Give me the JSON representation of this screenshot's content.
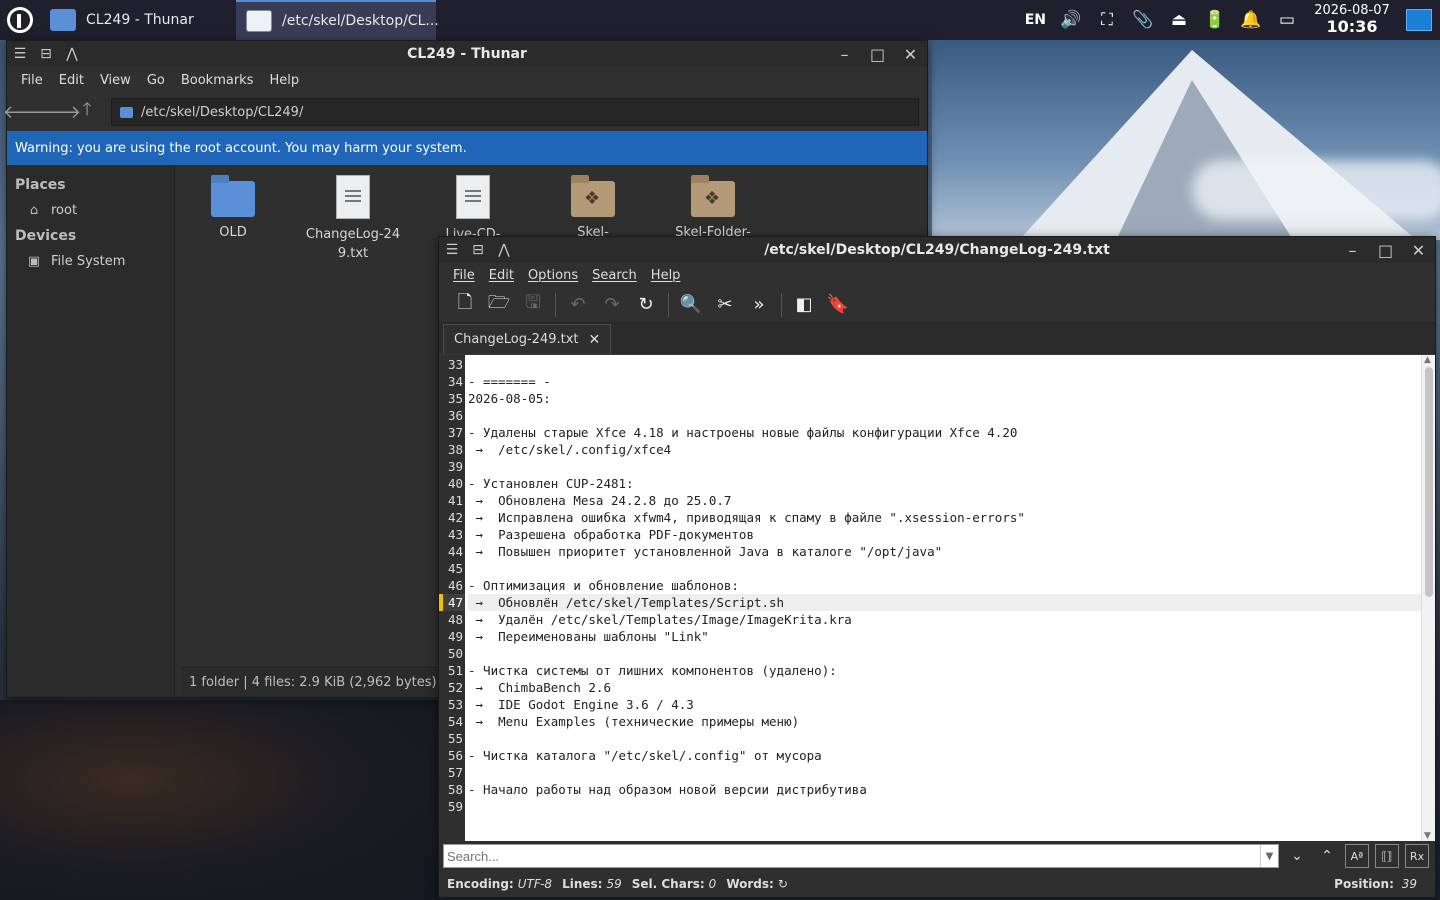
{
  "taskbar": {
    "tasks": [
      {
        "label": "CL249 - Thunar"
      },
      {
        "label": "/etc/skel/Desktop/CL..."
      }
    ],
    "language": "EN",
    "date": "2026-08-07",
    "time": "10:36"
  },
  "thunar": {
    "title": "CL249 - Thunar",
    "menu": [
      "File",
      "Edit",
      "View",
      "Go",
      "Bookmarks",
      "Help"
    ],
    "path": "/etc/skel/Desktop/CL249/",
    "warning": "Warning: you are using the root account. You may harm your system.",
    "sidebar": {
      "places_header": "Places",
      "places": [
        {
          "label": "root",
          "icon": "home-icon"
        }
      ],
      "devices_header": "Devices",
      "devices": [
        {
          "label": "File System",
          "icon": "drive-icon"
        }
      ]
    },
    "files": [
      {
        "name": "OLD",
        "icon": "folder-icon"
      },
      {
        "name": "ChangeLog-249.txt",
        "icon": "text-file-icon"
      },
      {
        "name": "Live-CD-",
        "icon": "text-file-icon"
      },
      {
        "name": "Skel-",
        "icon": "dropbox-folder-icon"
      },
      {
        "name": "Skel-Folder-",
        "icon": "dropbox-folder-icon"
      }
    ],
    "status": "1 folder  |  4 files: 2.9 KiB (2,962 bytes)"
  },
  "mousepad": {
    "title": "/etc/skel/Desktop/CL249/ChangeLog-249.txt",
    "menu": [
      "File",
      "Edit",
      "Options",
      "Search",
      "Help"
    ],
    "tab_label": "ChangeLog-249.txt",
    "current_line": 47,
    "lines": [
      {
        "n": "33",
        "t": ""
      },
      {
        "n": "34",
        "t": "- ======= -"
      },
      {
        "n": "35",
        "t": "2026-08-05:"
      },
      {
        "n": "36",
        "t": ""
      },
      {
        "n": "37",
        "t": "- Удалены старые Xfce 4.18 и настроены новые файлы конфигурации Xfce 4.20"
      },
      {
        "n": "38",
        "t": " →  /etc/skel/.config/xfce4"
      },
      {
        "n": "39",
        "t": ""
      },
      {
        "n": "40",
        "t": "- Установлен CUP-2481:"
      },
      {
        "n": "41",
        "t": " →  Обновлена Mesa 24.2.8 до 25.0.7"
      },
      {
        "n": "42",
        "t": " →  Исправлена ошибка xfwm4, приводящая к спаму в файле \".xsession-errors\""
      },
      {
        "n": "43",
        "t": " →  Разрешена обработка PDF-документов"
      },
      {
        "n": "44",
        "t": " →  Повышен приоритет установленной Java в каталоге \"/opt/java\""
      },
      {
        "n": "45",
        "t": ""
      },
      {
        "n": "46",
        "t": "- Оптимизация и обновление шаблонов:"
      },
      {
        "n": "47",
        "t": " →  Обновлён /etc/skel/Templates/Script.sh"
      },
      {
        "n": "48",
        "t": " →  Удалён /etc/skel/Templates/Image/ImageKrita.kra"
      },
      {
        "n": "49",
        "t": " →  Переименованы шаблоны \"Link\""
      },
      {
        "n": "50",
        "t": ""
      },
      {
        "n": "51",
        "t": "- Чистка системы от лишних компонентов (удалено):"
      },
      {
        "n": "52",
        "t": " →  ChimbaBench 2.6"
      },
      {
        "n": "53",
        "t": " →  IDE Godot Engine 3.6 / 4.3"
      },
      {
        "n": "54",
        "t": " →  Menu Examples (технические примеры меню)"
      },
      {
        "n": "55",
        "t": ""
      },
      {
        "n": "56",
        "t": "- Чистка каталога \"/etc/skel/.config\" от мусора"
      },
      {
        "n": "57",
        "t": ""
      },
      {
        "n": "58",
        "t": "- Начало работы над образом новой версии дистрибутива"
      },
      {
        "n": "59",
        "t": ""
      }
    ],
    "search_placeholder": "Search...",
    "status": {
      "encoding_label": "Encoding:",
      "encoding": "UTF-8",
      "lines_label": "Lines:",
      "lines": "59",
      "sel_label": "Sel. Chars:",
      "sel": "0",
      "words_label": "Words:",
      "position_label": "Position:",
      "position": "39"
    }
  }
}
